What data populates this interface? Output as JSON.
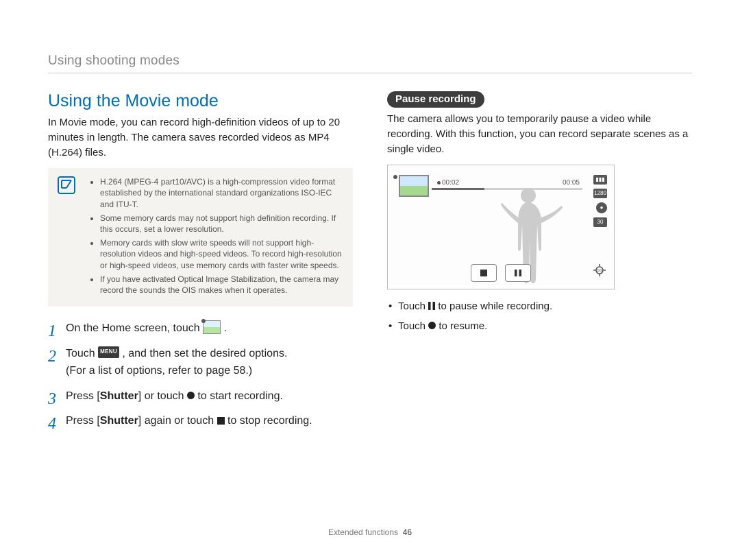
{
  "breadcrumb": "Using shooting modes",
  "left": {
    "title": "Using the Movie mode",
    "intro": "In Movie mode, you can record high-definition videos of up to 20 minutes in length. The camera saves recorded videos as MP4 (H.264) files.",
    "notes": [
      "H.264 (MPEG-4 part10/AVC) is a high-compression video format established by the international standard organizations ISO-IEC and ITU-T.",
      "Some memory cards may not support high definition recording. If this occurs, set a lower resolution.",
      "Memory cards with slow write speeds will not support high-resolution videos and high-speed videos. To record high-resolution or high-speed videos, use memory cards with faster write speeds.",
      "If you have activated Optical Image Stabilization, the camera may record the sounds the OIS makes when it operates."
    ],
    "steps": {
      "s1a": "On the Home screen, touch ",
      "s1b": ".",
      "s2a": "Touch ",
      "s2_menu": "MENU",
      "s2b": " , and then set the desired options.",
      "s2c": "(For a list of options, refer to page 58.)",
      "s3a": "Press [",
      "s3b": "Shutter",
      "s3c": "] or touch ",
      "s3d": " to start recording.",
      "s4a": "Press [",
      "s4b": "Shutter",
      "s4c": "] again or touch ",
      "s4d": " to stop recording."
    }
  },
  "right": {
    "pill": "Pause recording",
    "intro": "The camera allows you to temporarily pause a video while recording. With this function, you can record separate scenes as a single video.",
    "screenshot": {
      "time_elapsed": "00:02",
      "time_total": "00:05",
      "side_icons": [
        "batt",
        "1280",
        "mic",
        "30"
      ],
      "ois_label": "OIS"
    },
    "bullets": {
      "b1a": "Touch ",
      "b1b": " to pause while recording.",
      "b2a": "Touch ",
      "b2b": " to resume."
    }
  },
  "footer": {
    "section": "Extended functions",
    "page": "46"
  }
}
